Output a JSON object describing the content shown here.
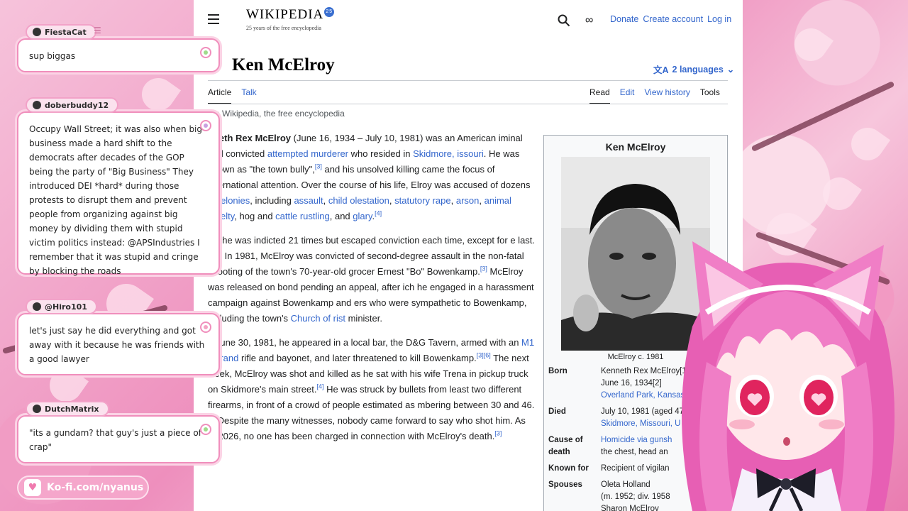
{
  "chat": [
    {
      "user": "FiestaCat",
      "text": "sup biggas"
    },
    {
      "user": "doberbuddy12",
      "text": "Occupy Wall Street; it was also when big business made a hard shift to the democrats after decades of the GOP being the party of \"Big Business\" They introduced DEI *hard* during those protests to disrupt them and prevent people from organizing against big money by dividing them with stupid victim politics instead: @APSIndustries I remember that it was stupid and cringe by blocking the roads"
    },
    {
      "user": "@Hiro101",
      "text": "let's just say he did everything and got away with it because he was friends with a good lawyer"
    },
    {
      "user": "DutchMatrix",
      "text": "\"its a gundam? that guy's just a piece of crap\""
    }
  ],
  "kofi": {
    "label": "Ko-fi.com/nyanus"
  },
  "wiki": {
    "wordmark": "WIKIPEDIA",
    "badge": "25",
    "tagline": "25 years of the free encyclopedia",
    "header_links": [
      "Donate",
      "Create account",
      "Log in"
    ],
    "title": "Ken McElroy",
    "languages": "2 languages",
    "tabs_left": [
      "Article",
      "Talk"
    ],
    "tabs_right": [
      "Read",
      "Edit",
      "View history",
      "Tools"
    ],
    "from": "om Wikipedia, the free encyclopedia",
    "infobox": {
      "title": "Ken McElroy",
      "caption": "McElroy c. 1981",
      "rows": [
        {
          "label": "Born",
          "lines": [
            "Kenneth Rex McElroy[1]",
            "June 16, 1934[2]",
            "Overland Park, Kansas, U"
          ]
        },
        {
          "label": "Died",
          "lines": [
            "July 10, 1981 (aged 47)",
            "Skidmore, Missouri, U"
          ]
        },
        {
          "label": "Cause of death",
          "lines": [
            "Homicide via gunsh",
            "the chest, head an"
          ]
        },
        {
          "label": "Known for",
          "lines": [
            "Recipient of vigilan"
          ]
        },
        {
          "label": "Spouses",
          "lines": [
            "Oleta Holland",
            "(m. 1952; div. 1958",
            "Sharon McElroy"
          ]
        }
      ]
    }
  },
  "colors": {
    "link": "#3366cc",
    "chat_border": "#f08ebc",
    "kofi": "#f5a6cb"
  }
}
